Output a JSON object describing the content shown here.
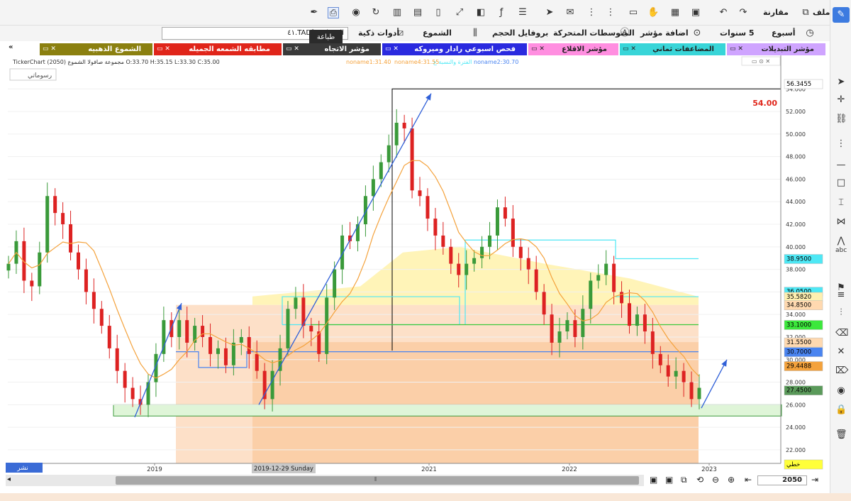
{
  "toolbar": {
    "file": "ملف",
    "compare": "مقارنة",
    "week": "أسبوع",
    "five_years": "5 سنوات",
    "add_indicator": "اضافة مؤشر",
    "moving_averages": "المتوسطات المتحركة",
    "volume_profile": "بروفايل الحجم",
    "candles": "الشموع",
    "smart_tools": "أدوات ذكية",
    "print_tooltip": "طباعة"
  },
  "search": {
    "value": "العمران - [TAD.٤١"
  },
  "tabs": [
    {
      "label": "مؤشر التبديلات",
      "color": "#cfa4ff"
    },
    {
      "label": "المضاعفات ثماني",
      "color": "#38d5d8"
    },
    {
      "label": "مؤشر الاقلاع",
      "color": "#ff8ee0"
    },
    {
      "label": "فحص اسبوعي رادار وميروكه",
      "color": "#2a2adf"
    },
    {
      "label": "مؤشر الاتجاه",
      "color": "#3a3a3a"
    },
    {
      "label": "مطابقه الشمعه الجميله",
      "color": "#e0251a"
    },
    {
      "label": "الشموع الذهبيه",
      "color": "#8b8010"
    }
  ],
  "chart": {
    "info_line": "TickerChart مجموعة صافولا الشموع (2050) O:33.70 H:35.15 L:33.30 C:35.00",
    "legend_noname1": "noname1:31.40",
    "legend_noname4": "noname4:31.55",
    "legend_noname5": "الفترة والنسبة ع",
    "legend_noname2": "noname2:30.70",
    "drawings_label": "رسوماتي",
    "target_label": "54.00",
    "share_label": "نشر",
    "date_label": "2019-12-29 Sunday"
  },
  "chart_data": {
    "type": "candlestick",
    "title": "",
    "x_ticks": [
      "2019",
      "2021",
      "2022",
      "2023"
    ],
    "y_ticks": [
      22.0,
      24.0,
      26.0,
      28.0,
      30.0,
      32.0,
      34.0,
      36.0,
      38.0,
      40.0,
      42.0,
      44.0,
      46.0,
      48.0,
      50.0,
      52.0,
      54.0
    ],
    "ylim": [
      20.8,
      56.3455
    ],
    "price_labels": [
      {
        "value": "56.3455",
        "color": "#ffffff"
      },
      {
        "value": "38.9500",
        "color": "#4ee8f5"
      },
      {
        "value": "36.0500",
        "color": "#4ee8f5"
      },
      {
        "value": "35.5820",
        "color": "#fff0b0"
      },
      {
        "value": "34.8500",
        "color": "#ffd9b0"
      },
      {
        "value": "33.1000",
        "color": "#3ce83c"
      },
      {
        "value": "31.5500",
        "color": "#ffd9b0"
      },
      {
        "value": "30.7000",
        "color": "#4a84f0"
      },
      {
        "value": "29.4488",
        "color": "#f4a23c"
      },
      {
        "value": "27.4500",
        "color": "#5a9a5a"
      },
      {
        "value": "خطي",
        "color": "#ffff3a"
      }
    ],
    "horizontal_levels": [
      {
        "value": 54.0,
        "color": "#000000"
      },
      {
        "value": 38.95,
        "color": "#4ee8f5"
      },
      {
        "value": 35.58,
        "color": "#4ee8f5"
      },
      {
        "value": 33.1,
        "color": "#3cc83c"
      },
      {
        "value": 30.7,
        "color": "#4a84f0"
      }
    ],
    "support_zone": [
      25.0,
      26.0
    ],
    "candles_close": [
      38.5,
      40.5,
      37.0,
      36.5,
      39.5,
      44.5,
      43.0,
      42.0,
      39.5,
      38.0,
      36.0,
      34.5,
      33.0,
      31.0,
      29.0,
      27.5,
      26.5,
      26.0,
      28.0,
      30.5,
      33.5,
      32.0,
      33.5,
      31.5,
      33.0,
      32.0,
      30.5,
      31.0,
      29.5,
      31.5,
      32.0,
      30.5,
      29.0,
      26.5,
      29.0,
      31.0,
      34.5,
      35.5,
      33.0,
      32.5,
      30.5,
      35.5,
      38.0,
      41.0,
      40.5,
      42.0,
      44.5,
      46.0,
      47.5,
      49.0,
      51.0,
      50.5,
      45.0,
      44.5,
      42.5,
      41.0,
      40.0,
      38.5,
      37.5,
      38.5,
      39.0,
      40.0,
      41.0,
      43.5,
      42.5,
      40.0,
      39.0,
      38.0,
      36.0,
      34.0,
      31.5,
      32.5,
      33.5,
      32.0,
      34.5,
      37.0,
      37.5,
      38.5,
      36.0,
      35.0,
      33.0,
      34.0,
      32.5,
      30.5,
      29.5,
      28.5,
      29.0,
      28.0,
      26.5,
      27.5
    ],
    "series": [
      {
        "name": "noname2",
        "color": "#f4a23c"
      }
    ]
  },
  "bottom": {
    "page": "2050"
  }
}
